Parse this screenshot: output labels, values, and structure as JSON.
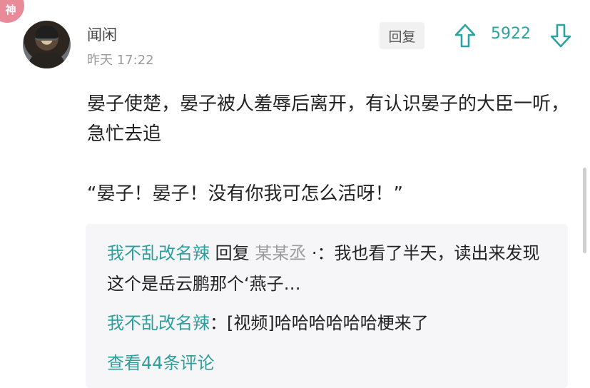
{
  "badge": {
    "label": "神"
  },
  "comment": {
    "username": "闻闲",
    "time": "昨天 17:22",
    "reply_label": "回复",
    "vote_count": "5922",
    "content": [
      "晏子使楚，晏子被人羞辱后离开，有认识晏子的大臣一听，急忙去追",
      "“晏子！晏子！没有你我可怎么活呀！”"
    ]
  },
  "replies": {
    "reply1": {
      "author": "我不乱改名辣",
      "verb": " 回复 ",
      "target": "某某丞",
      "text": "        ·：我也看了半天，读出来发现这个是岳云鹏那个‘燕子…"
    },
    "reply2": {
      "author": "我不乱改名辣",
      "text": "：[视频]哈哈哈哈哈哈梗来了"
    },
    "view_more": "查看44条评论"
  },
  "colors": {
    "accent": "#2c9e9b",
    "badge": "#e98a99"
  },
  "icons": [
    "upvote-arrow-icon",
    "downvote-arrow-icon"
  ]
}
